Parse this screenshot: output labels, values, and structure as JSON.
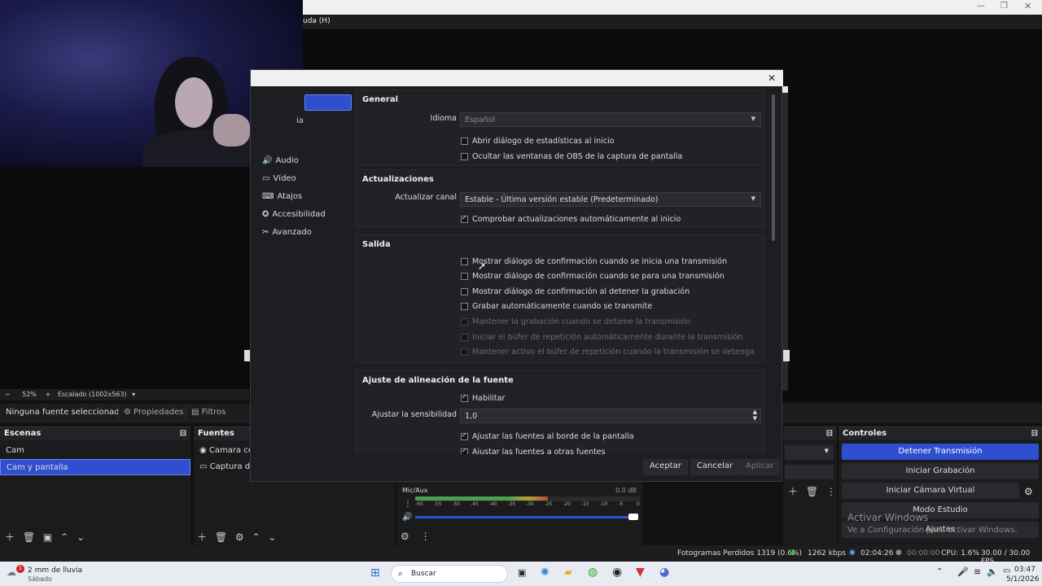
{
  "menu": {
    "help_fragment": "uda (H)"
  },
  "preview": {
    "zoom": "52%",
    "scale": "Escalado (1002x563)"
  },
  "source_bar": {
    "no_source": "Ninguna fuente seleccionad",
    "properties": "Propiedades",
    "filters": "Filtros"
  },
  "scenes": {
    "title": "Escenas",
    "items": [
      {
        "label": "Cam"
      },
      {
        "label": "Cam y pantalla",
        "selected": true
      }
    ]
  },
  "sources": {
    "title": "Fuentes",
    "items": [
      {
        "label": "Camara celu"
      },
      {
        "label": "Captura de p"
      }
    ]
  },
  "mixer": {
    "channel": "Mic/Aux",
    "db": "0.0 dB",
    "ticks": [
      "-60",
      "-55",
      "-50",
      "-45",
      "-40",
      "-35",
      "-30",
      "-25",
      "-20",
      "-15",
      "-10",
      "-5",
      "0"
    ],
    "level_fraction": 0.59
  },
  "controls": {
    "title": "Controles",
    "buttons": [
      {
        "label": "Detener Transmisión",
        "primary": true
      },
      {
        "label": "Iniciar Grabación"
      },
      {
        "label": "Iniciar Cámara Virtual"
      },
      {
        "label": "Modo Estudio"
      },
      {
        "label": "Ajustes"
      }
    ]
  },
  "watermark": {
    "line1": "Activar Windows",
    "line2": "Ve a Configuración para activar Windows."
  },
  "status": {
    "dropped": "Fotogramas Perdidos 1319 (0.6%)",
    "kbps": "1262 kbps",
    "stream_time": "02:04:26",
    "rec_time": "00:00:00",
    "cpu": "CPU: 1.6%",
    "fps": "30.00 / 30.00 FPS"
  },
  "taskbar": {
    "weather": "2 mm de lluvia",
    "weather_day": "Sábado",
    "search": "Buscar",
    "time": "03:47",
    "date": "5/1/2026",
    "badge": "1"
  },
  "dialog": {
    "sidebar": [
      {
        "label": "",
        "icon": "selected"
      },
      {
        "label": "ia",
        "icon": ""
      },
      {
        "label": "Audio",
        "icon": "audio-icon"
      },
      {
        "label": "Vídeo",
        "icon": "video-icon"
      },
      {
        "label": "Atajos",
        "icon": "keyboard-icon"
      },
      {
        "label": "Accesibilidad",
        "icon": "accessibility-icon"
      },
      {
        "label": "Avanzado",
        "icon": "tools-icon"
      }
    ],
    "general": {
      "title": "General",
      "language_label": "Idioma",
      "language_value": "Español",
      "cb_stats": "Abrir diálogo de estadísticas al inicio",
      "cb_hide": "Ocultar las ventanas de OBS de la captura de pantalla"
    },
    "updates": {
      "title": "Actualizaciones",
      "channel_label": "Actualizar canal",
      "channel_value": "Estable - Última versión estable (Predeterminado)",
      "cb_auto": "Comprobar actualizaciones automáticamente al inicio"
    },
    "output": {
      "title": "Salida",
      "items": [
        {
          "label": "Mostrar diálogo de confirmación cuando se inicia una transmisión",
          "checked": false,
          "disabled": false
        },
        {
          "label": "Mostrar diálogo de confirmación cuando se para una transmisión",
          "checked": false,
          "disabled": false
        },
        {
          "label": "Mostrar diálogo de confirmación al detener la grabación",
          "checked": false,
          "disabled": false
        },
        {
          "label": "Grabar automáticamente cuando se transmite",
          "checked": false,
          "disabled": false
        },
        {
          "label": "Mantener la grabación cuando se detiene la transmisión",
          "checked": false,
          "disabled": true
        },
        {
          "label": "Iniciar el búfer de repetición automáticamente durante la transmisión",
          "checked": false,
          "disabled": true
        },
        {
          "label": "Mantener activo el búfer de repetición cuando la transmisión se detenga",
          "checked": false,
          "disabled": true
        }
      ]
    },
    "snap": {
      "title": "Ajuste de alineación de la fuente",
      "enable": "Habilitar",
      "sens_label": "Ajustar la sensibilidad",
      "sens_value": "1,0",
      "cb_edge": "Ajustar las fuentes al borde de la pantalla",
      "cb_other": "Ajustar las fuentes a otras fuentes"
    },
    "buttons": {
      "ok": "Aceptar",
      "cancel": "Cancelar",
      "apply": "Aplicar"
    }
  }
}
